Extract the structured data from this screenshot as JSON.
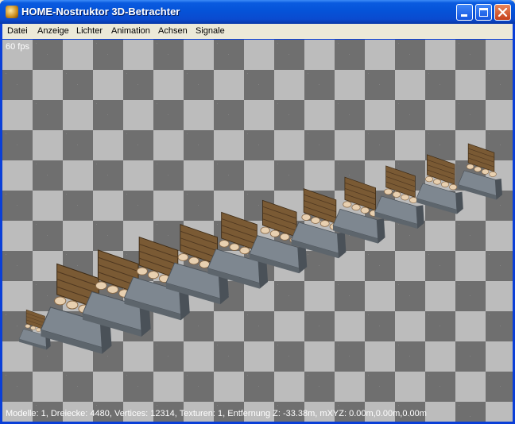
{
  "window": {
    "title": "HOME-Nostruktor 3D-Betrachter",
    "app_icon": "app-icon",
    "controls": [
      "minimize-icon",
      "maximize-icon",
      "close-icon"
    ]
  },
  "menu": [
    {
      "label": "Datei"
    },
    {
      "label": "Anzeige"
    },
    {
      "label": "Lichter"
    },
    {
      "label": "Animation"
    },
    {
      "label": "Achsen"
    },
    {
      "label": "Signale"
    }
  ],
  "viewport": {
    "fps": "60 fps",
    "status": "Modelle: 1, Dreiecke: 4480, Vertices: 12314, Texturen: 1, Entfernung Z: -33.38m, mXYZ: 0.00m,0.00m,0.00m",
    "model_segments": 12
  },
  "colors": {
    "checker_light": "#bcbcbc",
    "checker_dark": "#6f6f6f",
    "wood": "#7a5a34",
    "concrete": "#7e8790",
    "log": "#e8d0b0"
  }
}
